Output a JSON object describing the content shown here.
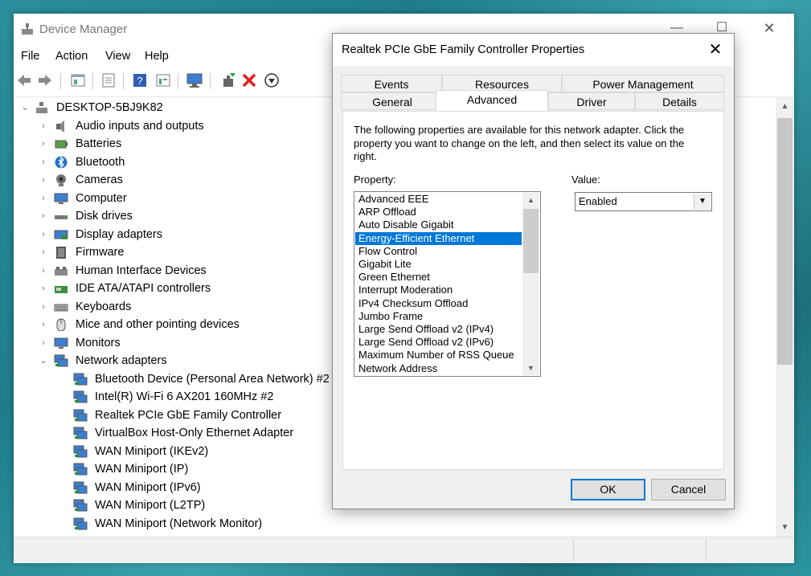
{
  "device_manager": {
    "title": "Device Manager",
    "window_controls": {
      "minimize": "—",
      "maximize": "☐",
      "close": "✕"
    },
    "menu": [
      "File",
      "Action",
      "View",
      "Help"
    ],
    "toolbar_icons": [
      "back-arrow-icon",
      "forward-arrow-icon",
      "properties-icon",
      "update-driver-icon",
      "help-icon",
      "device-view-icon",
      "monitor-icon",
      "enable-device-icon",
      "uninstall-device-icon",
      "scan-hardware-icon"
    ],
    "tree": {
      "root": "DESKTOP-5BJ9K82",
      "categories": [
        {
          "label": "Audio inputs and outputs",
          "icon": "speaker-icon",
          "expanded": false
        },
        {
          "label": "Batteries",
          "icon": "battery-icon",
          "expanded": false
        },
        {
          "label": "Bluetooth",
          "icon": "bluetooth-icon",
          "expanded": false
        },
        {
          "label": "Cameras",
          "icon": "camera-icon",
          "expanded": false
        },
        {
          "label": "Computer",
          "icon": "computer-icon",
          "expanded": false
        },
        {
          "label": "Disk drives",
          "icon": "disk-drive-icon",
          "expanded": false
        },
        {
          "label": "Display adapters",
          "icon": "display-adapter-icon",
          "expanded": false
        },
        {
          "label": "Firmware",
          "icon": "firmware-icon",
          "expanded": false
        },
        {
          "label": "Human Interface Devices",
          "icon": "hid-icon",
          "expanded": false
        },
        {
          "label": "IDE ATA/ATAPI controllers",
          "icon": "ide-controller-icon",
          "expanded": false
        },
        {
          "label": "Keyboards",
          "icon": "keyboard-icon",
          "expanded": false
        },
        {
          "label": "Mice and other pointing devices",
          "icon": "mouse-icon",
          "expanded": false
        },
        {
          "label": "Monitors",
          "icon": "monitor-icon",
          "expanded": false
        },
        {
          "label": "Network adapters",
          "icon": "network-adapter-icon",
          "expanded": true
        }
      ],
      "network_adapters": [
        "Bluetooth Device (Personal Area Network) #2",
        "Intel(R) Wi-Fi 6 AX201 160MHz #2",
        "Realtek PCIe GbE Family Controller",
        "VirtualBox Host-Only Ethernet Adapter",
        "WAN Miniport (IKEv2)",
        "WAN Miniport (IP)",
        "WAN Miniport (IPv6)",
        "WAN Miniport (L2TP)",
        "WAN Miniport (Network Monitor)"
      ]
    }
  },
  "properties_dialog": {
    "title": "Realtek PCIe GbE Family Controller Properties",
    "close_glyph": "✕",
    "tabs_top": [
      "Events",
      "Resources",
      "Power Management"
    ],
    "tabs_bottom": [
      "General",
      "Advanced",
      "Driver",
      "Details"
    ],
    "active_tab": "Advanced",
    "intro_text": "The following properties are available for this network adapter. Click the property you want to change on the left, and then select its value on the right.",
    "property_label": "Property:",
    "value_label": "Value:",
    "properties": [
      "Advanced EEE",
      "ARP Offload",
      "Auto Disable Gigabit",
      "Energy-Efficient Ethernet",
      "Flow Control",
      "Gigabit Lite",
      "Green Ethernet",
      "Interrupt Moderation",
      "IPv4 Checksum Offload",
      "Jumbo Frame",
      "Large Send Offload v2 (IPv4)",
      "Large Send Offload v2 (IPv6)",
      "Maximum Number of RSS Queue",
      "Network Address"
    ],
    "selected_property": "Energy-Efficient Ethernet",
    "value": "Enabled",
    "ok_label": "OK",
    "cancel_label": "Cancel"
  },
  "colors": {
    "selection": "#0078d7",
    "window": "#ffffff",
    "dialog": "#f0f0f0"
  }
}
